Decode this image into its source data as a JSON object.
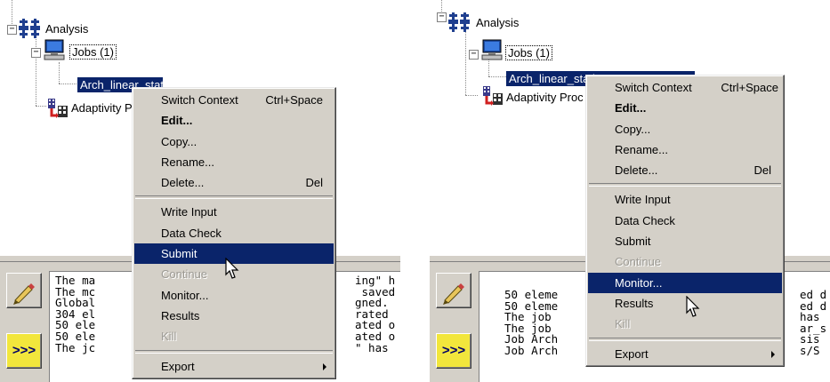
{
  "tree": {
    "analysis_label": "Analysis",
    "jobs_label": "Jobs (1)",
    "left_job_label": "Arch_linear_static",
    "right_job_label": "Arch_linear_static",
    "adaptivity_label": "Adaptivity Processes"
  },
  "menu_left": {
    "items": [
      {
        "label": "Switch Context",
        "shortcut": "Ctrl+Space"
      },
      {
        "label": "Edit..."
      },
      {
        "label": "Copy..."
      },
      {
        "label": "Rename..."
      },
      {
        "label": "Delete...",
        "shortcut": "Del"
      },
      {
        "label": "Write Input"
      },
      {
        "label": "Data Check"
      },
      {
        "label": "Submit"
      },
      {
        "label": "Continue"
      },
      {
        "label": "Monitor..."
      },
      {
        "label": "Results"
      },
      {
        "label": "Kill"
      },
      {
        "label": "Export"
      }
    ]
  },
  "menu_right": {
    "items": [
      {
        "label": "Switch Context",
        "shortcut": "Ctrl+Space"
      },
      {
        "label": "Edit..."
      },
      {
        "label": "Copy..."
      },
      {
        "label": "Rename..."
      },
      {
        "label": "Delete...",
        "shortcut": "Del"
      },
      {
        "label": "Write Input"
      },
      {
        "label": "Data Check"
      },
      {
        "label": "Submit"
      },
      {
        "label": "Continue"
      },
      {
        "label": "Monitor..."
      },
      {
        "label": "Results"
      },
      {
        "label": "Kill"
      },
      {
        "label": "Export"
      }
    ]
  },
  "console_left": {
    "left": [
      "The ma",
      "The mc",
      "Global",
      "304 el",
      "50 ele",
      "50 ele",
      "The jc"
    ],
    "right": [
      "ing\" h",
      " saved",
      "gned.",
      "rated",
      "ated o",
      "ated o",
      "\" has"
    ]
  },
  "console_right": {
    "left": [
      "50 eleme",
      "50 eleme",
      "The job",
      "The job",
      "Job Arch",
      "Job Arch"
    ],
    "right": [
      "ed d",
      "ed d",
      "has",
      "ar_s",
      "sis",
      "s/S"
    ]
  },
  "side_buttons": {
    "run_glyph": ">>>"
  },
  "colors": {
    "highlight": "#0a246a",
    "menu_bg": "#d4d0c8",
    "run_button": "#f2e63c"
  }
}
